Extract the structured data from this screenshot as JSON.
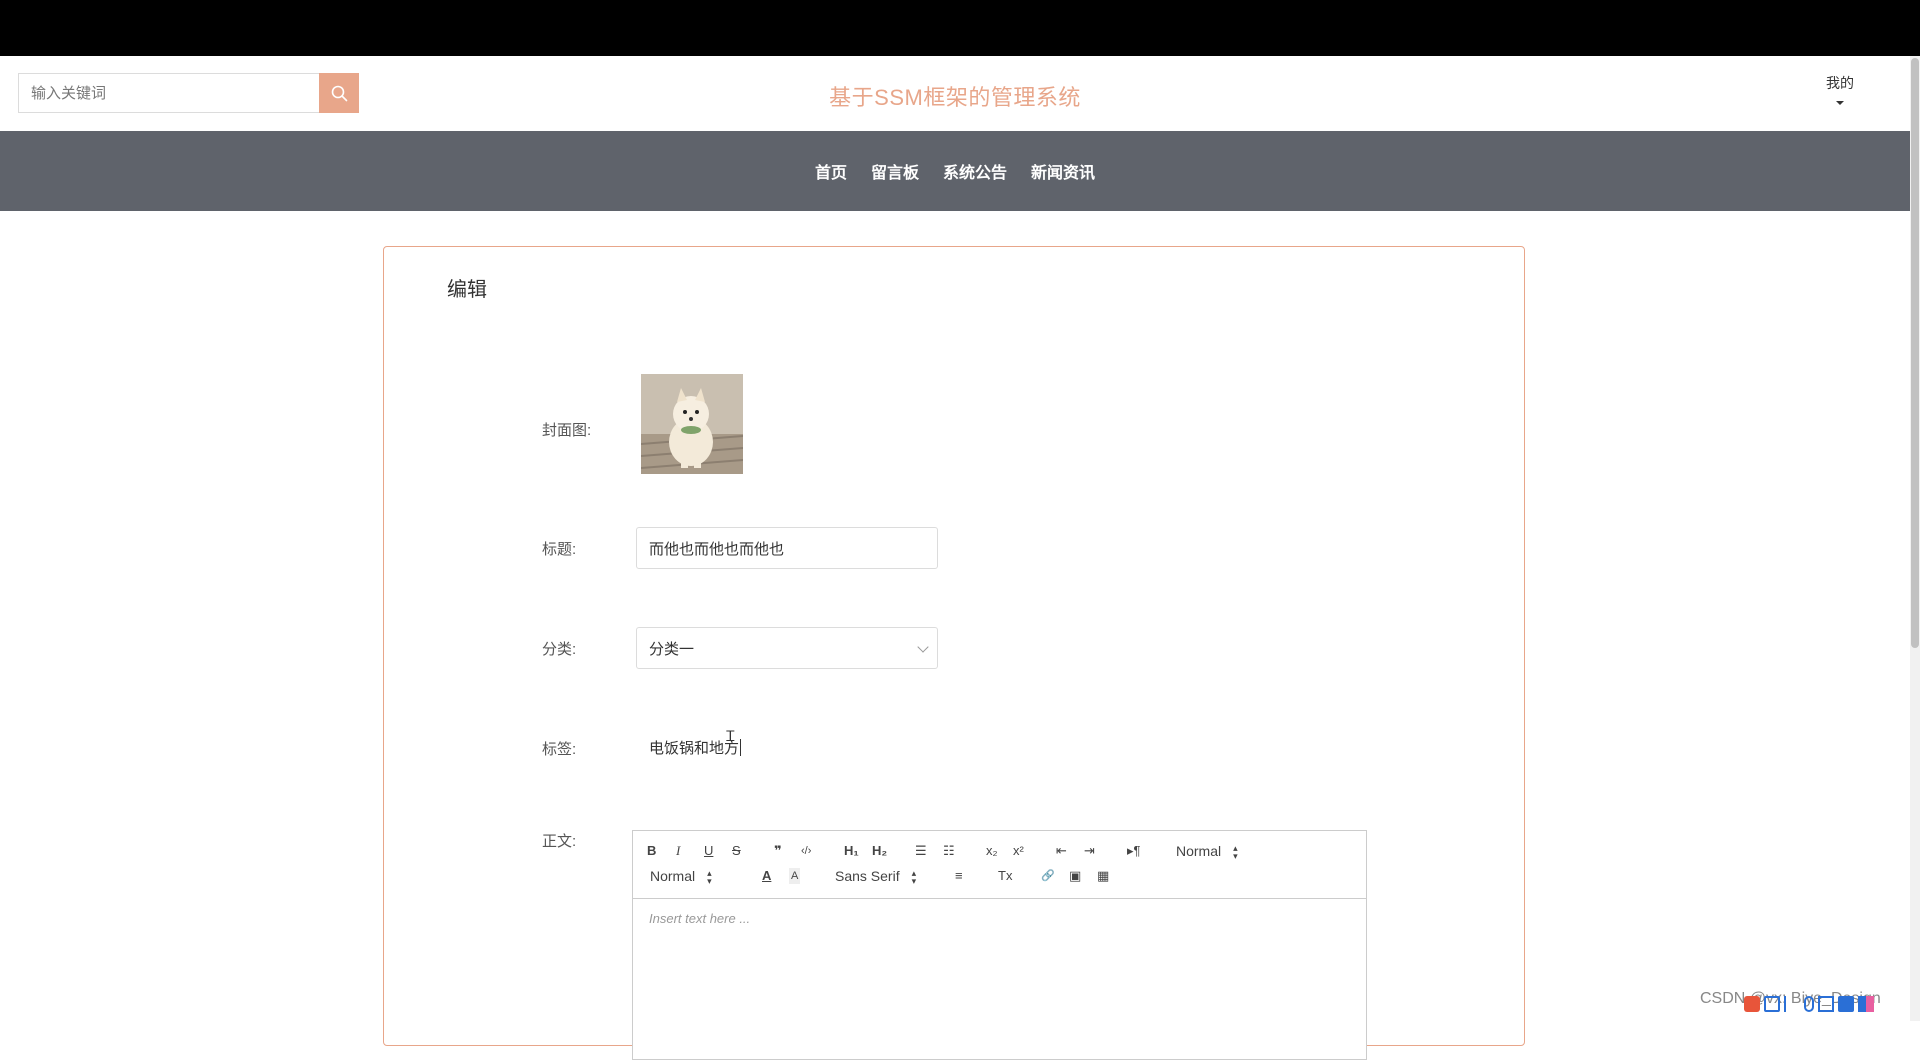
{
  "header": {
    "search_placeholder": "输入关键词",
    "site_title": "基于SSM框架的管理系统",
    "user_menu_label": "我的",
    "accent_color": "#e8a68a"
  },
  "nav": {
    "items": [
      {
        "label": "首页"
      },
      {
        "label": "留言板"
      },
      {
        "label": "系统公告"
      },
      {
        "label": "新闻资讯"
      }
    ],
    "background_color": "#5f636b"
  },
  "form": {
    "title": "编辑",
    "cover_label": "封面图:",
    "title_label": "标题:",
    "title_value": "而他也而他也而他也",
    "category_label": "分类:",
    "category_value": "分类一",
    "tags_label": "标签:",
    "tags_value": "电饭锅和地方",
    "body_label": "正文:",
    "editor": {
      "header_select": "Normal",
      "size_select": "Normal",
      "font_select": "Sans Serif",
      "placeholder": "Insert text here ...",
      "tools": {
        "bold": "B",
        "italic": "I",
        "underline": "U",
        "strike": "S",
        "quote": "❞",
        "code": "‹/›",
        "h1": "H₁",
        "h2": "H₂",
        "ordered": "☰",
        "bullet": "☷",
        "sub": "x₂",
        "sup": "x²",
        "outdent": "⇤",
        "indent": "⇥",
        "direction": "▸¶",
        "color": "A",
        "background": "A",
        "align": "≡",
        "clean": "Tx",
        "link": "🔗",
        "image": "▣",
        "video": "▦"
      }
    }
  },
  "watermark": "CSDN @vx: Biye_Design",
  "icons": {
    "search": "search-icon",
    "caret": "caret-down-icon"
  }
}
